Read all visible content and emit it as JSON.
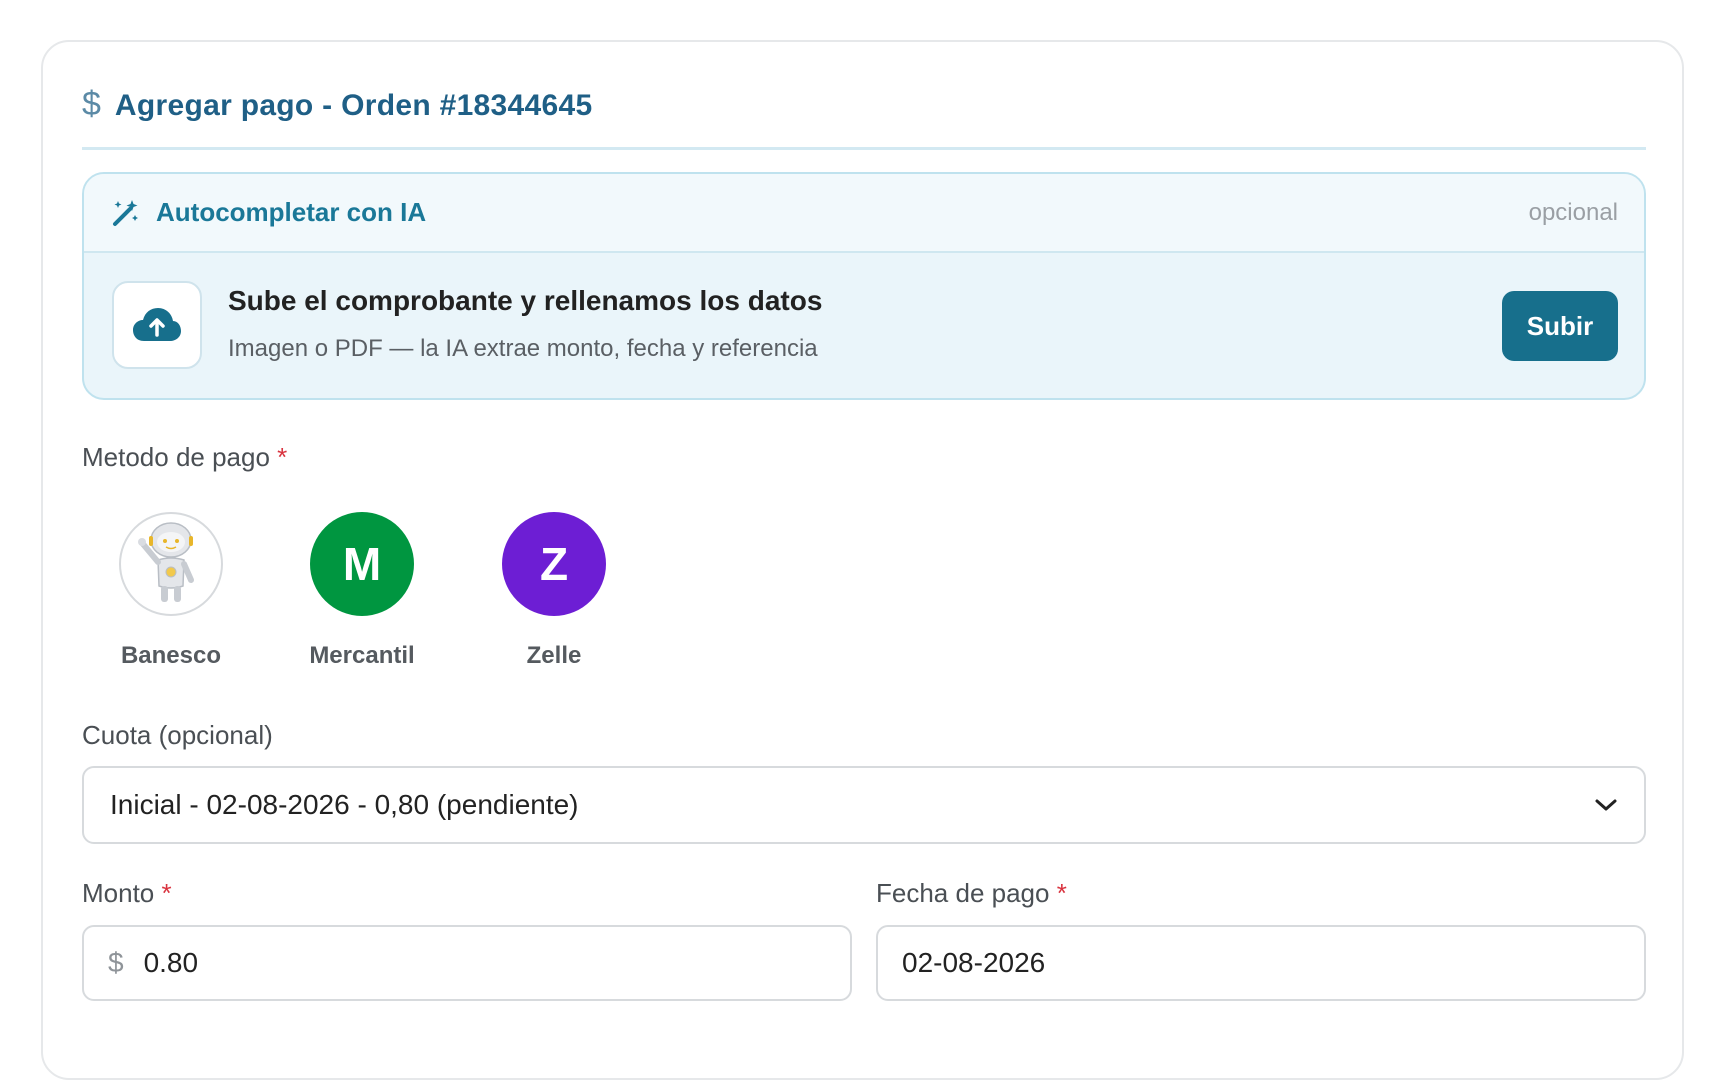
{
  "header": {
    "title": "Agregar pago - Orden #18344645",
    "dollar_symbol": "$"
  },
  "ai": {
    "title": "Autocompletar con IA",
    "optional_label": "opcional",
    "headline": "Sube el comprobante y rellenamos los datos",
    "subtext": "Imagen o PDF — la IA extrae monto, fecha y referencia",
    "upload_button": "Subir"
  },
  "payment_method": {
    "label": "Metodo de pago",
    "required_mark": "*",
    "options": [
      {
        "name": "Banesco",
        "initial": "",
        "icon": "robot-mascot-icon",
        "color": "#ffffff"
      },
      {
        "name": "Mercantil",
        "initial": "M",
        "icon": "letter-avatar",
        "color": "#009640"
      },
      {
        "name": "Zelle",
        "initial": "Z",
        "icon": "letter-avatar",
        "color": "#6d1ed4"
      }
    ]
  },
  "installment": {
    "label": "Cuota (opcional)",
    "selected": "Inicial - 02-08-2026 - 0,80 (pendiente)"
  },
  "amount": {
    "label": "Monto",
    "required_mark": "*",
    "prefix": "$",
    "value": "0.80"
  },
  "date": {
    "label": "Fecha de pago",
    "required_mark": "*",
    "value": "02-08-2026"
  },
  "colors": {
    "primary": "#176f8c",
    "title": "#1f5f86",
    "required": "#d9333f"
  }
}
